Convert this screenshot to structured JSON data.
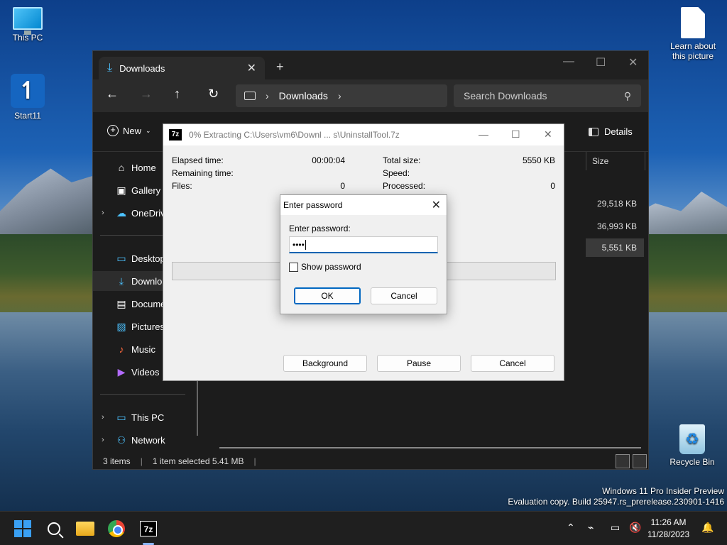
{
  "desktop": {
    "icons": [
      {
        "label": "This PC"
      },
      {
        "label": "Start11"
      },
      {
        "label": "Learn about this picture"
      },
      {
        "label": "Recycle Bin"
      }
    ],
    "watermark": {
      "line1": "Windows 11 Pro Insider Preview",
      "line2": "Evaluation copy. Build 25947.rs_prerelease.230901-1416"
    }
  },
  "explorer": {
    "tab_label": "Downloads",
    "address": {
      "segment": "Downloads"
    },
    "search_placeholder": "Search Downloads",
    "toolbar": {
      "new_label": "New",
      "details_label": "Details"
    },
    "sidebar": [
      {
        "label": "Home",
        "icon": "home-icon"
      },
      {
        "label": "Gallery",
        "icon": "gallery-icon"
      },
      {
        "label": "OneDrive",
        "icon": "cloud-icon"
      },
      {
        "label": "Desktop",
        "icon": "desktop-icon"
      },
      {
        "label": "Downloads",
        "icon": "download-icon"
      },
      {
        "label": "Documents",
        "icon": "document-icon"
      },
      {
        "label": "Pictures",
        "icon": "pictures-icon"
      },
      {
        "label": "Music",
        "icon": "music-icon"
      },
      {
        "label": "Videos",
        "icon": "videos-icon"
      },
      {
        "label": "This PC",
        "icon": "pc-icon"
      },
      {
        "label": "Network",
        "icon": "network-icon"
      }
    ],
    "columns": {
      "size": "Size"
    },
    "sizes": [
      "29,518 KB",
      "36,993 KB",
      "5,551 KB"
    ],
    "status": {
      "items": "3 items",
      "selected": "1 item selected  5.41 MB"
    }
  },
  "sevenzip": {
    "logo": "7z",
    "title": "0% Extracting C:\\Users\\vm6\\Downl ... s\\UninstallTool.7z",
    "fields": {
      "elapsed_label": "Elapsed time:",
      "elapsed_value": "00:00:04",
      "remaining_label": "Remaining time:",
      "files_label": "Files:",
      "files_value": "0",
      "total_label": "Total size:",
      "total_value": "5550 KB",
      "speed_label": "Speed:",
      "processed_label": "Processed:",
      "processed_value": "0"
    },
    "progress": 0,
    "buttons": {
      "background": "Background",
      "pause": "Pause",
      "cancel": "Cancel"
    }
  },
  "password_dialog": {
    "title": "Enter password",
    "label": "Enter password:",
    "value": "••••",
    "show_password": "Show password",
    "ok": "OK",
    "cancel": "Cancel"
  },
  "taskbar": {
    "time": "11:26 AM",
    "date": "11/28/2023",
    "tb_7z": "7z"
  }
}
